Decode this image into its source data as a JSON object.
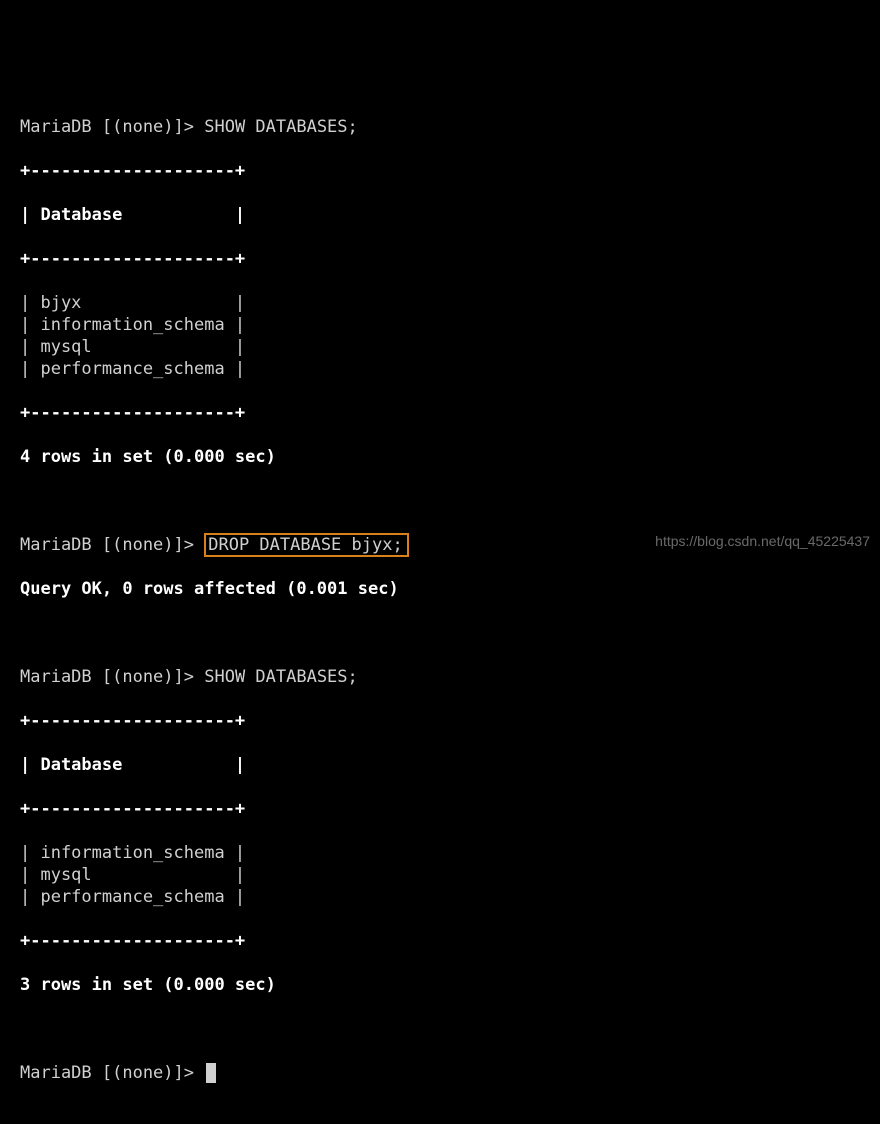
{
  "block1": {
    "prompt": "MariaDB [(none)]> ",
    "cmd": "SHOW DATABASES;",
    "sep": "+--------------------+",
    "header": "Database",
    "rows": [
      "bjyx",
      "information_schema",
      "mysql",
      "performance_schema"
    ],
    "summary": "4 rows in set (0.000 sec)"
  },
  "block2": {
    "prompt": "MariaDB [(none)]> ",
    "cmd": "DROP DATABASE bjyx;",
    "result": "Query OK, 0 rows affected (0.001 sec)"
  },
  "block3": {
    "prompt": "MariaDB [(none)]> ",
    "cmd": "SHOW DATABASES;",
    "sep": "+--------------------+",
    "header": "Database",
    "rows": [
      "information_schema",
      "mysql",
      "performance_schema"
    ],
    "summary": "3 rows in set (0.000 sec)"
  },
  "block4": {
    "prompt": "MariaDB [(none)]> "
  },
  "watermark": "https://blog.csdn.net/qq_45225437",
  "cell_inner_width": 18
}
